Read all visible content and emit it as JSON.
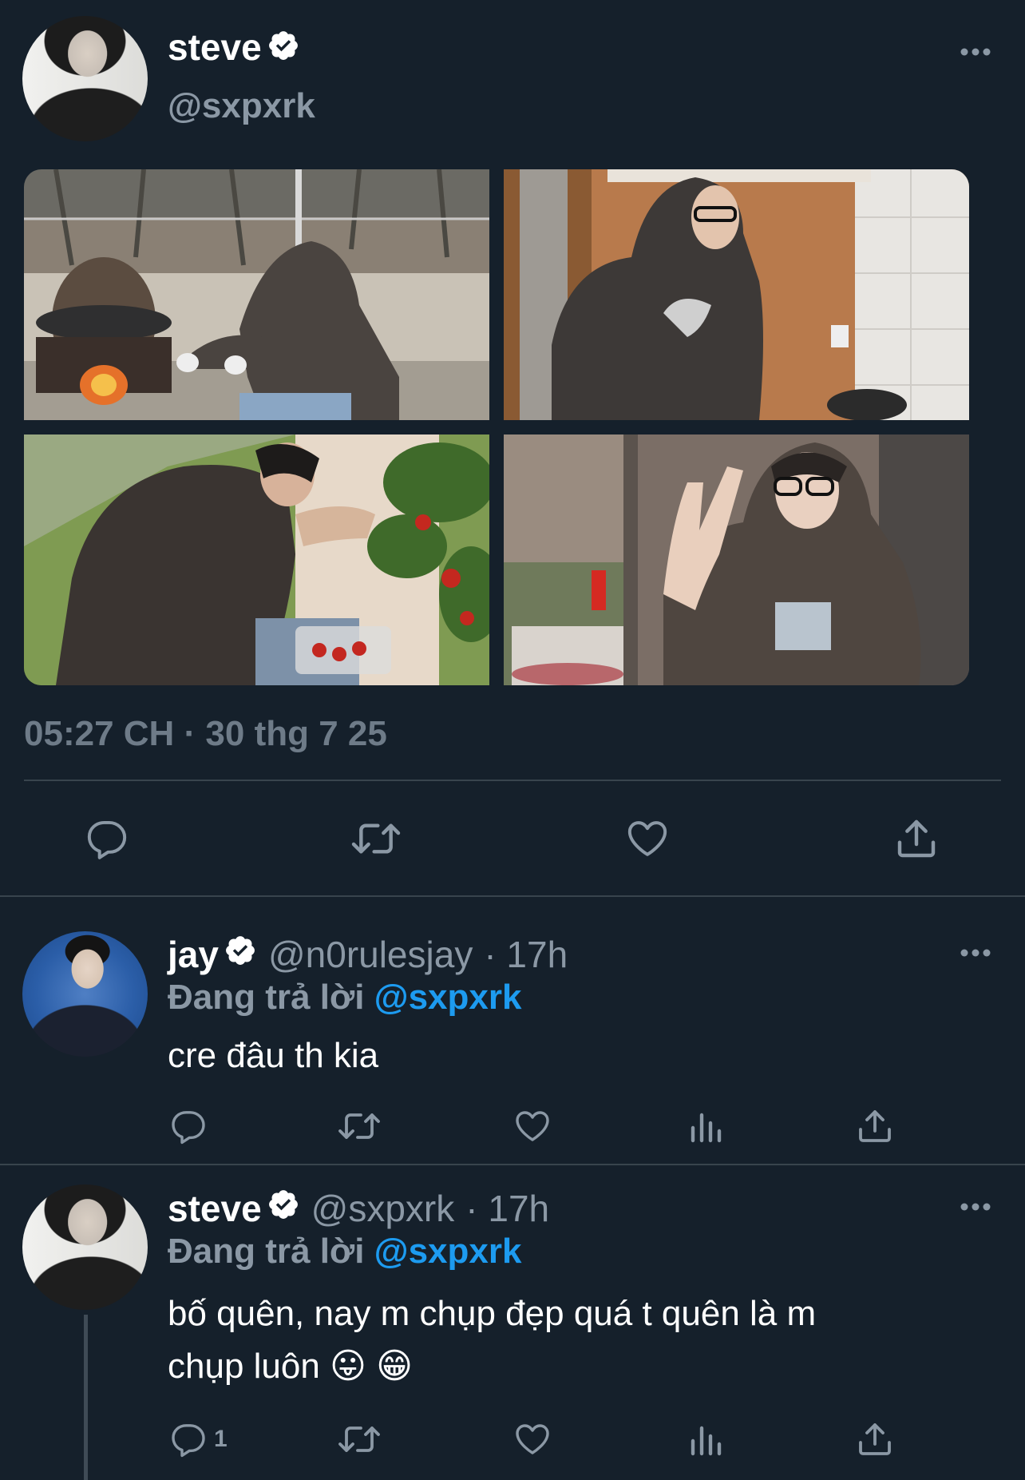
{
  "main_tweet": {
    "name": "steve",
    "handle": "@sxpxrk",
    "timestamp": "05:27 CH · 30 thg 7 25",
    "photos": [
      "hooded person crouching by campfire outdoors",
      "hooded person in glasses indoors near orange wall",
      "hooded person picking strawberries in greenhouse",
      "hooded person in glasses making peace sign"
    ]
  },
  "replies": [
    {
      "name": "jay",
      "handle": "@n0rulesjay",
      "time": "· 17h",
      "replying_label": "Đang trả lời",
      "replying_to": "@sxpxrk",
      "text": "cre đâu th kia",
      "reply_count": ""
    },
    {
      "name": "steve",
      "handle": "@sxpxrk",
      "time": "· 17h",
      "replying_label": "Đang trả lời",
      "replying_to": "@sxpxrk",
      "text_line1": "bố quên, nay m chụp đẹp quá t quên là m",
      "text_line2": "chụp luôn 😛 😁",
      "reply_count": "1"
    }
  ],
  "colors": {
    "background": "#15202b",
    "muted": "#8b98a5",
    "accent": "#1d9bf0",
    "divider": "#38444d"
  },
  "icons": [
    "verified-badge-icon",
    "more-icon",
    "reply-icon",
    "retweet-icon",
    "like-icon",
    "views-icon",
    "share-icon"
  ]
}
